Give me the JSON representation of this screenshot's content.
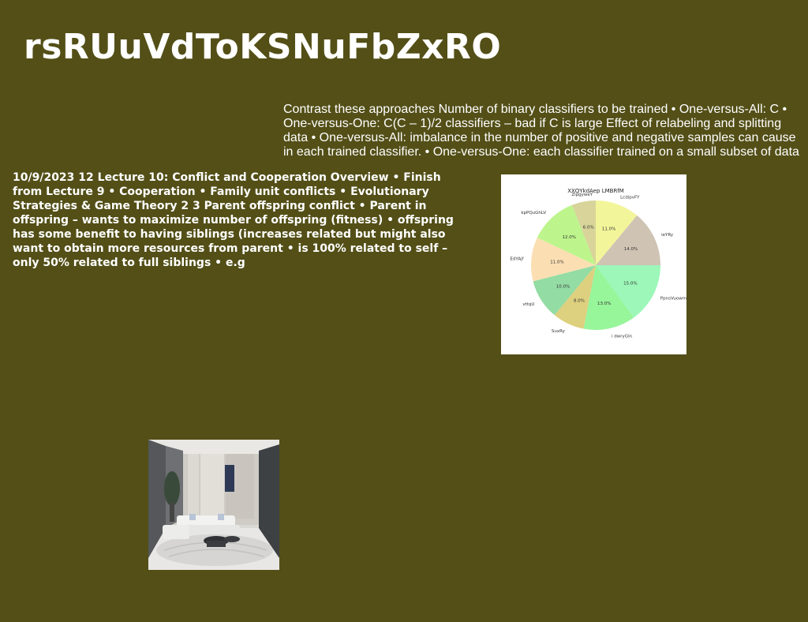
{
  "page": {
    "title": "rsRUuVdToKSNuFbZxRO",
    "right_paragraph": "Contrast these approaches Number of binary classifiers to be trained • One-versus-All: C • One-versus-One: C(C – 1)/2 classifiers – bad if C is large Effect of relabeling and splitting data • One-versus-All: imbalance in the number of positive and negative samples can cause in each trained classifier. • One-versus-One: each classifier trained on a small subset of data",
    "left_paragraph": "10/9/2023 12 Lecture 10: Conflict and Cooperation Overview • Finish from Lecture 9 • Cooperation • Family unit conflicts • Evolutionary Strategies & Game Theory 2 3 Parent offspring conflict • Parent in offspring – wants to maximize number of offspring (fitness) • offspring has some benefit to having siblings (increases related but might also want to obtain more resources from parent • is 100% related to self – only 50% related to full siblings • e.g",
    "colors": {
      "background": "#534f17",
      "text": "#ffffff"
    }
  },
  "chart_data": {
    "type": "pie",
    "title": "XXQYkdAep LMBRfM",
    "labels": [
      "LcdipvFY",
      "ieYRy",
      "PpnsVuowm",
      "i dwryGln",
      "SuxRy",
      "vttqU",
      "EdYAjf",
      "kpPQuGhLV",
      "ZipgyweY"
    ],
    "values": [
      11.0,
      14.0,
      15.0,
      13.0,
      8.0,
      10.0,
      11.0,
      12.0,
      6.0
    ],
    "value_labels": [
      "11.0%",
      "14.0%",
      "15.0%",
      "13.0%",
      "8.0%",
      "10.0%",
      "11.0%",
      "12.0%",
      "6.0%"
    ],
    "colors": [
      "#f3f59a",
      "#cfc3b3",
      "#9cf7b8",
      "#97f59a",
      "#ddd07e",
      "#93dca3",
      "#fbdfb3",
      "#bdf58c",
      "#d8d49a"
    ],
    "start_angle_deg": 90,
    "direction": "clockwise",
    "legend": "none"
  },
  "image": {
    "icon": "living-room-photo"
  }
}
